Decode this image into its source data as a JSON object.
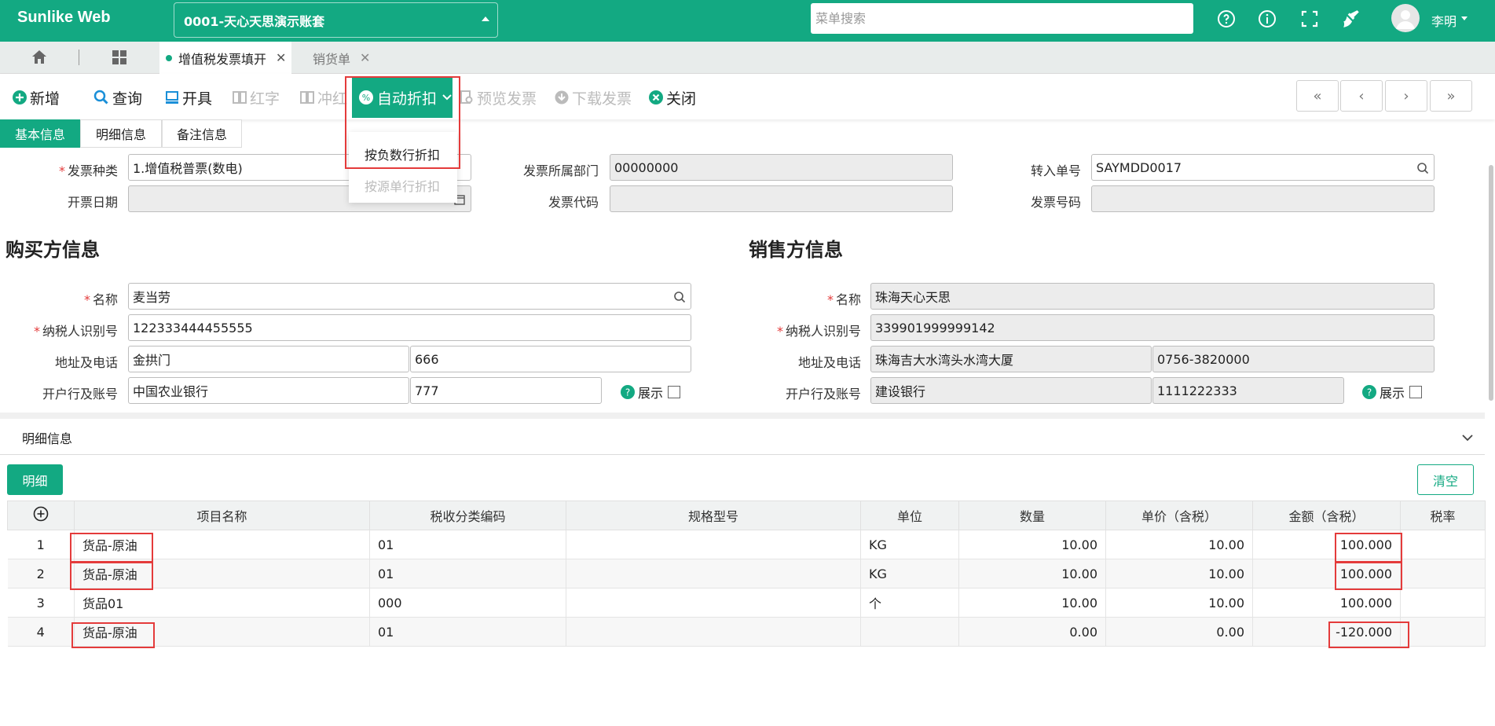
{
  "app": {
    "title": "Sunlike Web",
    "account": "0001-天心天思演示账套",
    "search_placeholder": "菜单搜索",
    "user": "李明"
  },
  "tabs": [
    {
      "label": "增值税发票填开"
    },
    {
      "label": "销货单"
    }
  ],
  "toolbar": {
    "new": "新增",
    "query": "查询",
    "issue": "开具",
    "red": "红字",
    "offset": "冲红",
    "auto_discount": "自动折扣",
    "preview": "预览发票",
    "download": "下载发票",
    "close": "关闭",
    "nav": [
      "«",
      "‹",
      "›",
      "»"
    ]
  },
  "dropdown": {
    "negative_row": "按负数行折扣",
    "source_row": "按源单行折扣"
  },
  "subtabs": [
    "基本信息",
    "明细信息",
    "备注信息"
  ],
  "form": {
    "invoice_type_label": "发票种类",
    "invoice_type": "1.增值税普票(数电)",
    "dept_label": "发票所属部门",
    "dept": "00000000",
    "source_no_label": "转入单号",
    "source_no": "SAYMDD0017",
    "date_label": "开票日期",
    "code_label": "发票代码",
    "number_label": "发票号码"
  },
  "buyer": {
    "title": "购买方信息",
    "name_label": "名称",
    "name": "麦当劳",
    "tax_label": "纳税人识别号",
    "tax": "122333444455555",
    "addr_label": "地址及电话",
    "addr": "金拱门",
    "phone": "666",
    "bank_label": "开户行及账号",
    "bank": "中国农业银行",
    "account": "777",
    "show_label": "展示"
  },
  "seller": {
    "title": "销售方信息",
    "name_label": "名称",
    "name": "珠海天心天思",
    "tax_label": "纳税人识别号",
    "tax": "339901999999142",
    "addr_label": "地址及电话",
    "addr": "珠海吉大水湾头水湾大厦",
    "phone": "0756-3820000",
    "bank_label": "开户行及账号",
    "bank": "建设银行",
    "account": "1111222333",
    "show_label": "展示"
  },
  "detail": {
    "section": "明细信息",
    "detail_btn": "明细",
    "clear_btn": "清空",
    "columns": [
      "项目名称",
      "税收分类编码",
      "规格型号",
      "单位",
      "数量",
      "单价（含税）",
      "金额（含税）",
      "税率"
    ],
    "rows": [
      {
        "no": "1",
        "name": "货品-原油",
        "code": "01",
        "spec": "",
        "unit": "KG",
        "qty": "10.00",
        "price": "10.00",
        "amount": "100.000"
      },
      {
        "no": "2",
        "name": "货品-原油",
        "code": "01",
        "spec": "",
        "unit": "KG",
        "qty": "10.00",
        "price": "10.00",
        "amount": "100.000"
      },
      {
        "no": "3",
        "name": "货品01",
        "code": "000",
        "spec": "",
        "unit": "个",
        "qty": "10.00",
        "price": "10.00",
        "amount": "100.000"
      },
      {
        "no": "4",
        "name": "货品-原油",
        "code": "01",
        "spec": "",
        "unit": "",
        "qty": "0.00",
        "price": "0.00",
        "amount": "-120.000"
      }
    ]
  },
  "colors": {
    "brand": "#13a982",
    "highlight": "#e43b3b"
  }
}
